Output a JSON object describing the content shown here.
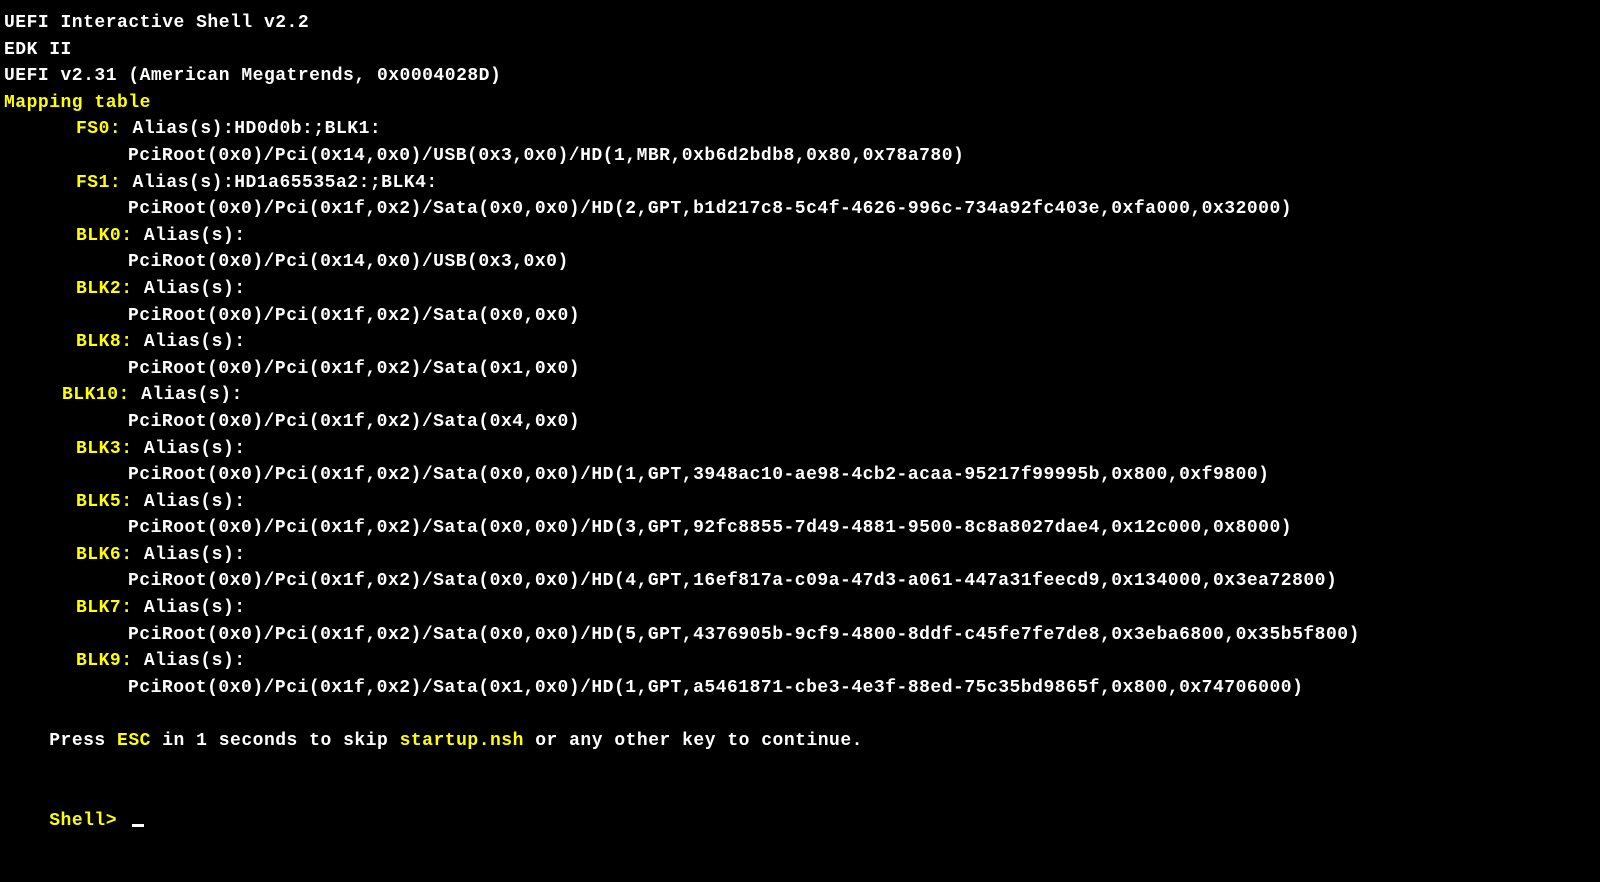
{
  "header": {
    "line1": "UEFI Interactive Shell v2.2",
    "line2": "EDK II",
    "line3": "UEFI v2.31 (American Megatrends, 0x0004028D)",
    "mapping_title": "Mapping table"
  },
  "entries": [
    {
      "name": "FS0:",
      "alias_label": "Alias(s):",
      "alias_value": "HD0d0b:;BLK1:",
      "path": "PciRoot(0x0)/Pci(0x14,0x0)/USB(0x3,0x0)/HD(1,MBR,0xb6d2bdb8,0x80,0x78a780)",
      "indent": "indent2"
    },
    {
      "name": "FS1:",
      "alias_label": "Alias(s):",
      "alias_value": "HD1a65535a2:;BLK4:",
      "path": "PciRoot(0x0)/Pci(0x1f,0x2)/Sata(0x0,0x0)/HD(2,GPT,b1d217c8-5c4f-4626-996c-734a92fc403e,0xfa000,0x32000)",
      "indent": "indent2"
    },
    {
      "name": "BLK0:",
      "alias_label": "Alias(s):",
      "alias_value": "",
      "path": "PciRoot(0x0)/Pci(0x14,0x0)/USB(0x3,0x0)",
      "indent": "indent2"
    },
    {
      "name": "BLK2:",
      "alias_label": "Alias(s):",
      "alias_value": "",
      "path": "PciRoot(0x0)/Pci(0x1f,0x2)/Sata(0x0,0x0)",
      "indent": "indent2"
    },
    {
      "name": "BLK8:",
      "alias_label": "Alias(s):",
      "alias_value": "",
      "path": "PciRoot(0x0)/Pci(0x1f,0x2)/Sata(0x1,0x0)",
      "indent": "indent2"
    },
    {
      "name": "BLK10:",
      "alias_label": "Alias(s):",
      "alias_value": "",
      "path": "PciRoot(0x0)/Pci(0x1f,0x2)/Sata(0x4,0x0)",
      "indent": "indent1"
    },
    {
      "name": "BLK3:",
      "alias_label": "Alias(s):",
      "alias_value": "",
      "path": "PciRoot(0x0)/Pci(0x1f,0x2)/Sata(0x0,0x0)/HD(1,GPT,3948ac10-ae98-4cb2-acaa-95217f99995b,0x800,0xf9800)",
      "indent": "indent2"
    },
    {
      "name": "BLK5:",
      "alias_label": "Alias(s):",
      "alias_value": "",
      "path": "PciRoot(0x0)/Pci(0x1f,0x2)/Sata(0x0,0x0)/HD(3,GPT,92fc8855-7d49-4881-9500-8c8a8027dae4,0x12c000,0x8000)",
      "indent": "indent2"
    },
    {
      "name": "BLK6:",
      "alias_label": "Alias(s):",
      "alias_value": "",
      "path": "PciRoot(0x0)/Pci(0x1f,0x2)/Sata(0x0,0x0)/HD(4,GPT,16ef817a-c09a-47d3-a061-447a31feecd9,0x134000,0x3ea72800)",
      "indent": "indent2"
    },
    {
      "name": "BLK7:",
      "alias_label": "Alias(s):",
      "alias_value": "",
      "path": "PciRoot(0x0)/Pci(0x1f,0x2)/Sata(0x0,0x0)/HD(5,GPT,4376905b-9cf9-4800-8ddf-c45fe7fe7de8,0x3eba6800,0x35b5f800)",
      "indent": "indent2"
    },
    {
      "name": "BLK9:",
      "alias_label": "Alias(s):",
      "alias_value": "",
      "path": "PciRoot(0x0)/Pci(0x1f,0x2)/Sata(0x1,0x0)/HD(1,GPT,a5461871-cbe3-4e3f-88ed-75c35bd9865f,0x800,0x74706000)",
      "indent": "indent2"
    }
  ],
  "footer": {
    "press_prefix": "Press ",
    "esc": "ESC",
    "mid1": " in 1 seconds to skip ",
    "startup": "startup.nsh",
    "mid2": " or any other key to continue.",
    "prompt": "Shell> "
  }
}
